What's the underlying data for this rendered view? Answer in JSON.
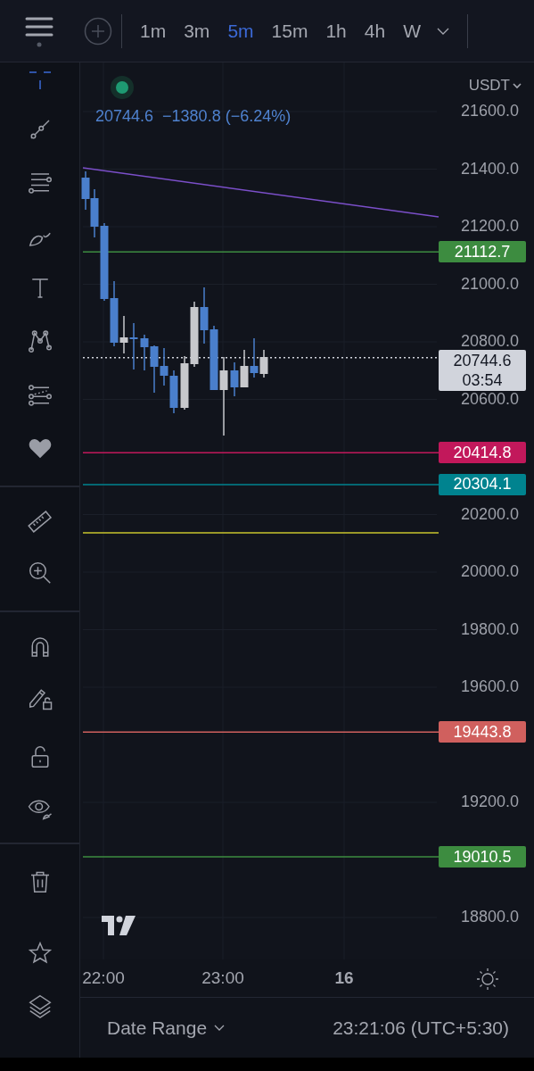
{
  "toolbar": {
    "intervals": [
      {
        "label": "1m",
        "selected": false
      },
      {
        "label": "3m",
        "selected": false
      },
      {
        "label": "5m",
        "selected": true
      },
      {
        "label": "15m",
        "selected": false
      },
      {
        "label": "1h",
        "selected": false
      },
      {
        "label": "4h",
        "selected": false
      },
      {
        "label": "W",
        "selected": false
      }
    ]
  },
  "header": {
    "last_price": "20744.6",
    "change": "−1380.8 (−6.24%)",
    "currency": "USDT"
  },
  "price_axis": {
    "labels": [
      "21600.0",
      "21400.0",
      "21200.0",
      "21000.0",
      "20800.0",
      "20600.0",
      "20200.0",
      "20000.0",
      "19800.0",
      "19600.0",
      "19200.0",
      "18800.0"
    ]
  },
  "levels": [
    {
      "price": "21112.7",
      "color": "#3d8c40"
    },
    {
      "price": "20414.8",
      "color": "#c2185b"
    },
    {
      "price": "20304.1",
      "color": "#00838f"
    },
    {
      "price": "19443.8",
      "color": "#d0605e"
    },
    {
      "price": "19010.5",
      "color": "#3d8c40"
    }
  ],
  "last_price_tag": {
    "price": "20744.6",
    "countdown": "03:54"
  },
  "time_axis": {
    "labels": [
      {
        "text": "22:00",
        "kind": "time"
      },
      {
        "text": "23:00",
        "kind": "time"
      },
      {
        "text": "16",
        "kind": "date"
      }
    ]
  },
  "footer": {
    "date_range": "Date Range",
    "clock": "23:21:06 (UTC+5:30)"
  }
}
